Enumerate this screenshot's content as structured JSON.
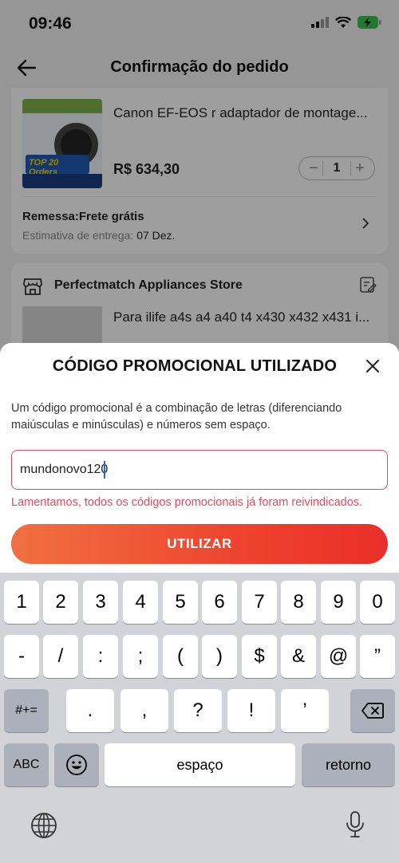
{
  "status_bar": {
    "time": "09:46"
  },
  "nav": {
    "title": "Confirmação do pedido"
  },
  "order_item_1": {
    "title": "Canon EF-EOS r adaptador de montage...",
    "thumb_badge": "TOP 20 Orders",
    "price": "R$ 634,30",
    "quantity": "1",
    "shipping_label": "Remessa:Frete grátis",
    "delivery_prefix": "Estimativa de entrega:",
    "delivery_date": "07 Dez."
  },
  "store": {
    "name": "Perfectmatch Appliances Store",
    "item_title": "Para ilife a4s a4 a40 t4 x430 x432 x431 i..."
  },
  "promo_sheet": {
    "title": "CÓDIGO PROMOCIONAL UTILIZADO",
    "description": "Um código promocional é a combinação de letras (diferenciando maiúsculas e minúsculas) e números sem espaço.",
    "input_value": "mundonovo120",
    "error": "Lamentamos, todos os códigos promocionais já foram reivindicados.",
    "submit_label": "UTILIZAR"
  },
  "keyboard": {
    "row1": [
      "1",
      "2",
      "3",
      "4",
      "5",
      "6",
      "7",
      "8",
      "9",
      "0"
    ],
    "row2": [
      "-",
      "/",
      ":",
      ";",
      "(",
      ")",
      "$",
      "&",
      "@",
      "”"
    ],
    "row3": [
      ".",
      ",",
      "?",
      "!",
      "’"
    ],
    "symbols_key": "#+=",
    "abc_key": "ABC",
    "space_key": "espaço",
    "return_key": "retorno"
  },
  "colors": {
    "accent": "#ee3d2c",
    "error": "#e8485e"
  }
}
